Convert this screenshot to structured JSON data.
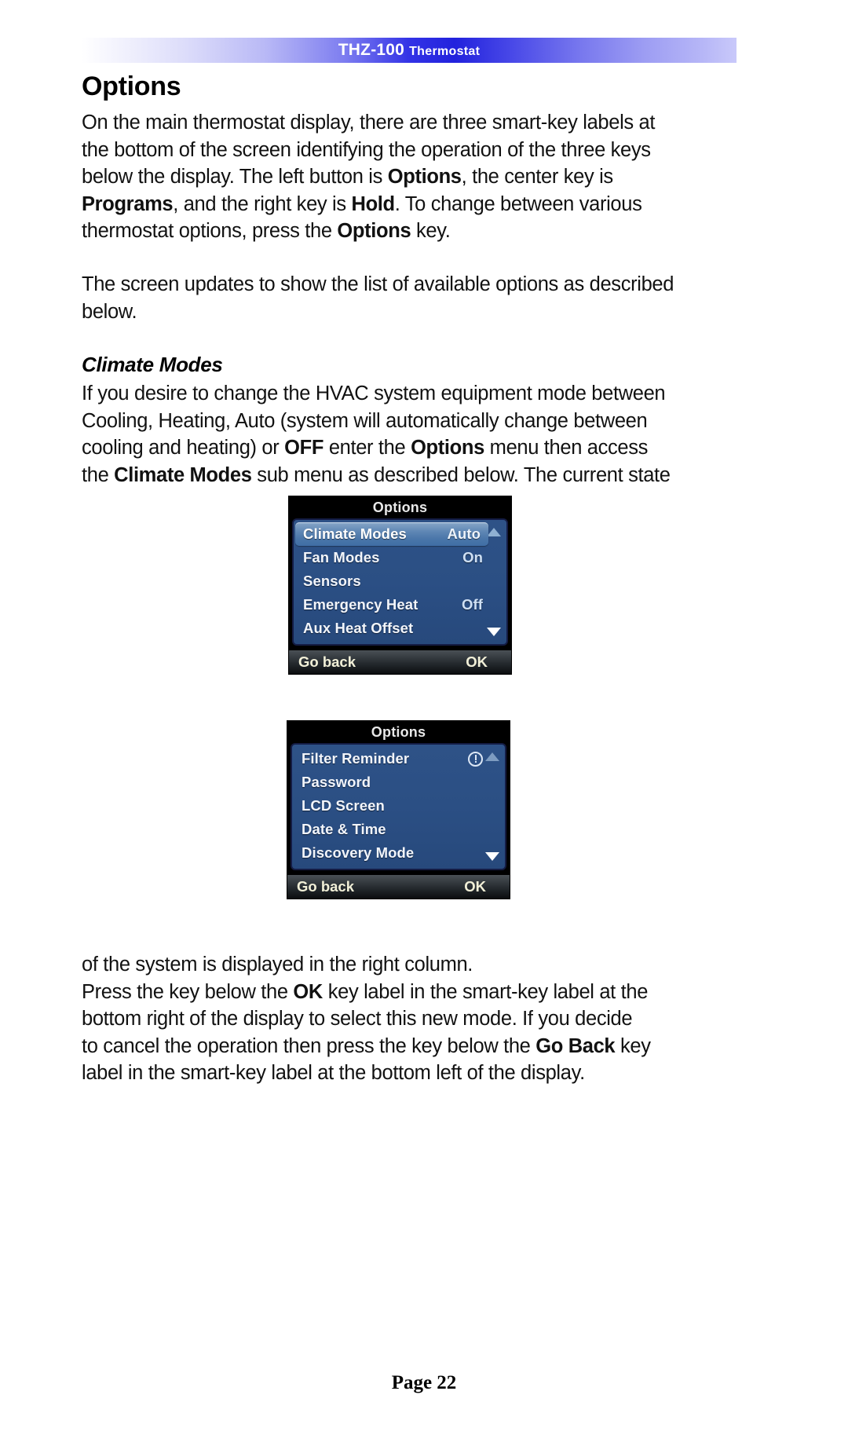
{
  "header": {
    "product": "THZ-100",
    "doc_label": "Thermostat",
    "band_start_color": "#ffffff",
    "band_mid_color": "#2222dd",
    "band_end_color": "#c9c9fa"
  },
  "page_title": "Options",
  "paragraphs": {
    "intro_1": "On the main thermostat display, there are three smart-key labels at",
    "intro_2": "the bottom of the screen identifying the operation of the three keys",
    "intro_3a": "below the display.  The left button is ",
    "intro_3b": "Options",
    "intro_3c": ", the center key is",
    "intro_4a": "Programs",
    "intro_4b": ", and the right key is ",
    "intro_4c": "Hold",
    "intro_4d": ".  To change between various",
    "intro_5a": "thermostat options, press the ",
    "intro_5b": "Options",
    "intro_5c": " key.",
    "updates_1": "The screen updates to show the list of available options as described",
    "updates_2": "below."
  },
  "subheading": "Climate Modes",
  "climate_para": {
    "l1": "If you desire to change the HVAC system equipment mode between",
    "l2": "Cooling, Heating, Auto (system will automatically change between",
    "l3a": "cooling and heating) or ",
    "l3b": "OFF",
    "l3c": " enter the ",
    "l3d": "Options",
    "l3e": " menu then access",
    "l4a": "the ",
    "l4b": "Climate Modes",
    "l4c": " sub menu as described below.  The current state"
  },
  "lcd_screens": [
    {
      "title": "Options",
      "rows": [
        {
          "label": "Climate Modes",
          "value": "Auto",
          "selected": true,
          "icon": ""
        },
        {
          "label": "Fan Modes",
          "value": "On",
          "selected": false,
          "icon": ""
        },
        {
          "label": "Sensors",
          "value": "",
          "selected": false,
          "icon": ""
        },
        {
          "label": "Emergency Heat",
          "value": "Off",
          "selected": false,
          "icon": ""
        },
        {
          "label": "Aux Heat Offset",
          "value": "",
          "selected": false,
          "icon": ""
        }
      ],
      "scroll_up": "scroll-up-arrow-icon",
      "scroll_down": "scroll-down-arrow-icon",
      "softkey_left": "Go back",
      "softkey_right": "OK"
    },
    {
      "title": "Options",
      "rows": [
        {
          "label": "Filter Reminder",
          "value": "",
          "selected": false,
          "icon": "warning-exclamation-icon"
        },
        {
          "label": "Password",
          "value": "",
          "selected": false,
          "icon": ""
        },
        {
          "label": "LCD Screen",
          "value": "",
          "selected": false,
          "icon": ""
        },
        {
          "label": "Date & Time",
          "value": "",
          "selected": false,
          "icon": ""
        },
        {
          "label": "Discovery Mode",
          "value": "",
          "selected": false,
          "icon": ""
        }
      ],
      "scroll_up": "scroll-up-arrow-icon",
      "scroll_down": "scroll-down-arrow-icon",
      "softkey_left": "Go back",
      "softkey_right": "OK"
    }
  ],
  "closing_para": {
    "l1": "of the system is displayed in the right column.",
    "l2a": "Press the key below the ",
    "l2b": "OK",
    "l2c": " key label in the smart-key label at the",
    "l3": "bottom right of the display to select this new mode.  If you decide",
    "l4a": "to cancel the operation then press the key below the ",
    "l4b": "Go Back",
    "l4c": " key",
    "l5": "label in the smart-key label at the bottom left of the display."
  },
  "footer": "Page 22"
}
